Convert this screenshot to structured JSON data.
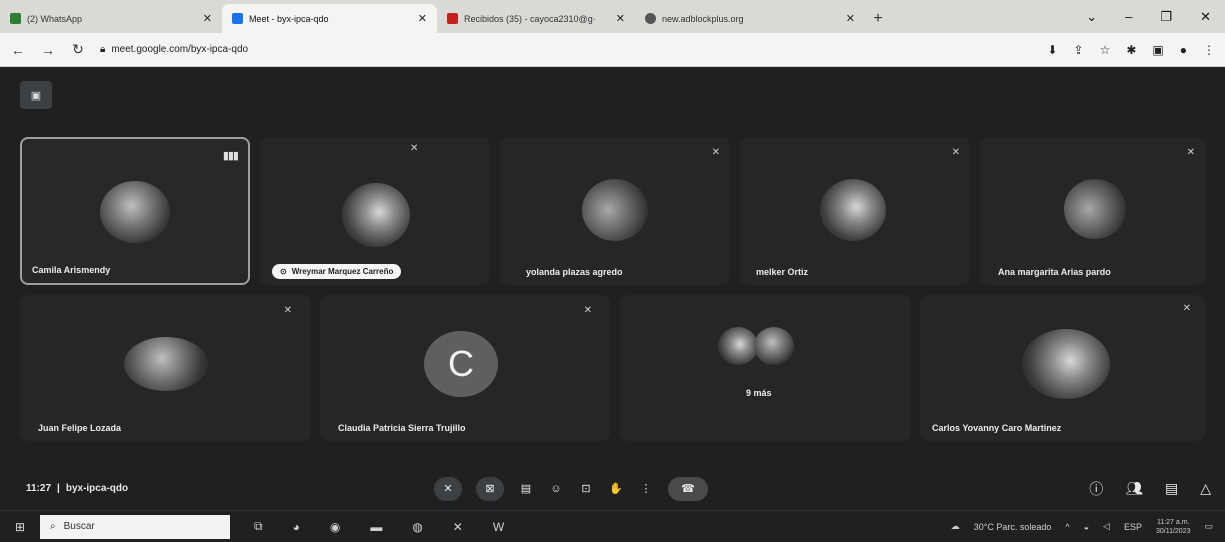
{
  "browser": {
    "tabs": [
      {
        "label": "(2) WhatsApp",
        "color": "#2e7d32"
      },
      {
        "label": "Meet - byx-ipca-qdo",
        "color": "#1a73e8"
      },
      {
        "label": "Recibidos (35) - cayoca2310@g·",
        "color": "#c5221f"
      },
      {
        "label": "new.adblockplus.org",
        "color": "#555555"
      }
    ],
    "url": "meet.google.com/byx-ipca-qdo",
    "new_tab": "+"
  },
  "meet": {
    "participants": [
      {
        "name": "Camila Arismendy"
      },
      {
        "name": "Wreymar Marquez Carreño"
      },
      {
        "name": "yolanda plazas agredo"
      },
      {
        "name": "melker Ortiz"
      },
      {
        "name": "Ana margarita Arias pardo"
      },
      {
        "name": "Juan Felipe Lozada"
      },
      {
        "name": "Claudia Patricia Sierra Trujillo",
        "initial": "C"
      },
      {
        "name": "9 más"
      },
      {
        "name": "Carlos Yovanny Caro Martinez"
      }
    ],
    "time": "11:27",
    "separator": "|",
    "code": "byx-ipca-qdo"
  },
  "taskbar": {
    "search_placeholder": "Buscar",
    "weather": "30°C Parc. soleado",
    "lang": "ESP",
    "time": "11:27 a.m.",
    "date": "30/11/2023"
  },
  "colors": {
    "meet_bg": "#202020",
    "tile_bg": "#262626",
    "end_call": "#4a4a4a"
  }
}
